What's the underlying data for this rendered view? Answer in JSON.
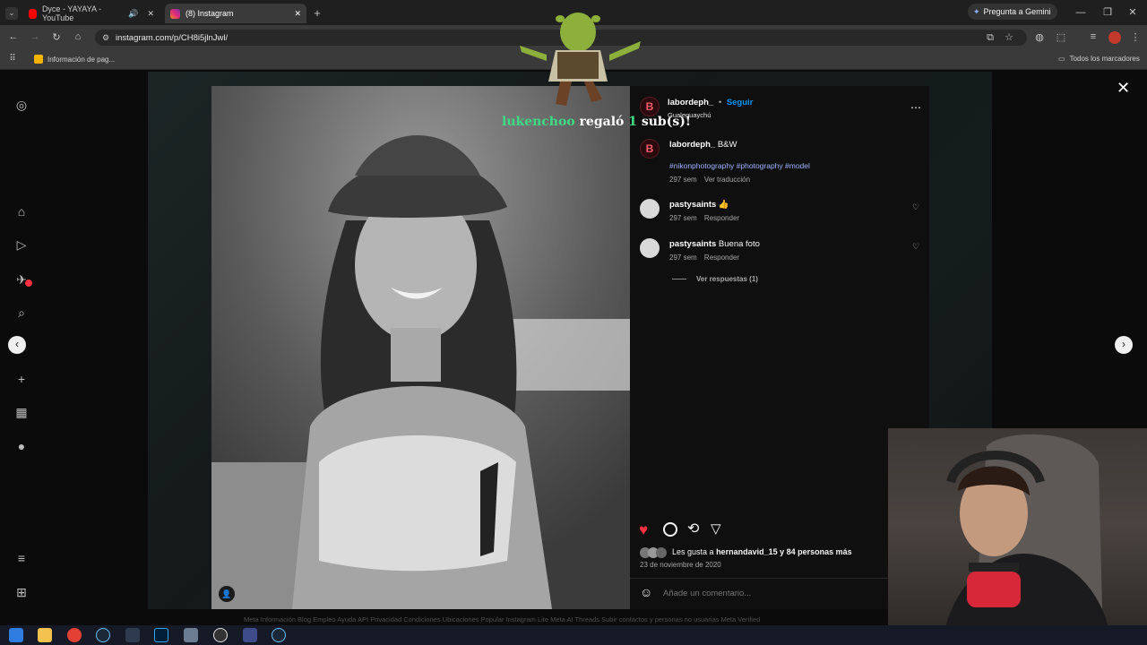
{
  "browser": {
    "tabs": [
      {
        "title": "Dyce - YAYAYA - YouTube",
        "active": false
      },
      {
        "title": "(8) Instagram",
        "active": true
      }
    ],
    "url": "instagram.com/p/CH8i5jlnJwl/",
    "gemini_label": "Pregunta a Gemini",
    "bookmark": "Información de pag...",
    "all_bookmarks": "Todos los marcadores"
  },
  "overlay": {
    "gift_user": "lukenchoo",
    "gift_text": "regaló",
    "gift_count": "1",
    "gift_suffix": "sub(s)!"
  },
  "post": {
    "author": "labordeph_",
    "follow_label": "Seguir",
    "location": "Gualeguaychú",
    "caption_user": "labordeph_",
    "caption_text": "B&W",
    "hashtags": "#nikonphotography #photography #model",
    "caption_time": "297 sem",
    "translate_label": "Ver traducción",
    "comments": [
      {
        "user": "pastysaints",
        "text": "👍",
        "time": "297 sem",
        "reply": "Responder"
      },
      {
        "user": "pastysaints",
        "text": "Buena foto",
        "time": "297 sem",
        "reply": "Responder"
      }
    ],
    "view_replies": "Ver respuestas (1)",
    "likes_prefix": "Les gusta a",
    "likes_user": "hernandavid_15",
    "likes_suffix": "y 84 personas más",
    "date": "23 de noviembre de 2020",
    "add_comment_placeholder": "Añade un comentario..."
  },
  "footer_links": "Meta   Información   Blog   Empleo   Ayuda   API   Privacidad   Condiciones   Ubicaciones   Popular   Instagram Lite   Meta AI   Threads   Subir contactos y personas no usuarias   Meta Verified",
  "colors": {
    "accent_link": "#0095f6",
    "like_red": "#ff3040",
    "gift_green": "#3ddc84"
  }
}
